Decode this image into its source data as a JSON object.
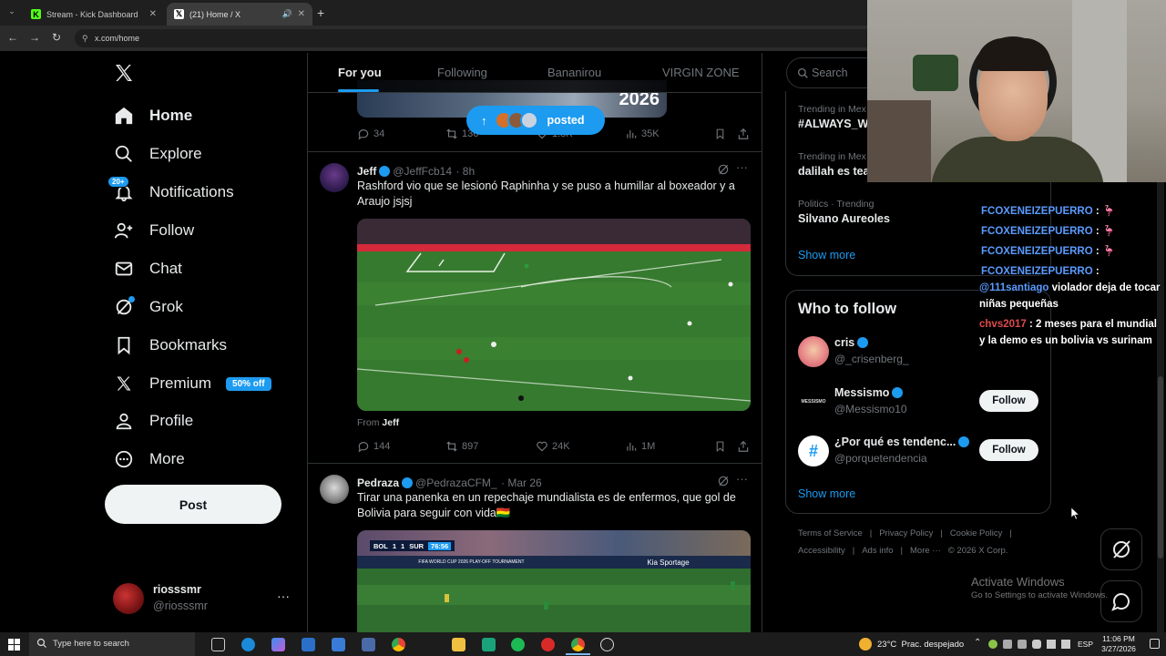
{
  "browser": {
    "tabs": [
      {
        "label": "Stream - Kick Dashboard"
      },
      {
        "label": "(21) Home / X"
      }
    ],
    "url": "x.com/home"
  },
  "sidebar": {
    "items": [
      {
        "label": "Home",
        "icon": "home-icon"
      },
      {
        "label": "Explore",
        "icon": "search-icon"
      },
      {
        "label": "Notifications",
        "icon": "bell-icon",
        "badge": "20+"
      },
      {
        "label": "Follow",
        "icon": "person-plus-icon"
      },
      {
        "label": "Chat",
        "icon": "mail-icon"
      },
      {
        "label": "Grok",
        "icon": "grok-icon"
      },
      {
        "label": "Bookmarks",
        "icon": "bookmark-icon"
      },
      {
        "label": "Premium",
        "icon": "x-logo-icon",
        "badge": "50% off"
      },
      {
        "label": "Profile",
        "icon": "person-icon"
      },
      {
        "label": "More",
        "icon": "more-circle-icon"
      }
    ],
    "post_label": "Post",
    "account": {
      "name": "riosssmr",
      "handle": "@riosssmr"
    }
  },
  "feed": {
    "tabs": [
      "For you",
      "Following",
      "Bananirou",
      "VIRGIN ZONE"
    ],
    "posted_pill": "posted",
    "top_tweet": {
      "replies": "34",
      "reposts": "136",
      "likes": "1.8K",
      "views": "35K",
      "banner_text": "2026"
    },
    "tweets": [
      {
        "name": "Jeff",
        "handle": "@JeffFcb14",
        "time": "· 8h",
        "text": "Rashford vio que se lesionó Raphinha y se puso a humillar al boxeador y a Araujo jsjsj",
        "from_label": "From",
        "from_name": "Jeff",
        "replies": "144",
        "reposts": "897",
        "likes": "24K",
        "views": "1M"
      },
      {
        "name": "Pedraza",
        "handle": "@PedrazaCFM_",
        "time": "· Mar 26",
        "text": "Tirar una panenka en un repechaje mundialista es de enfermos, que gol de Bolivia para seguir con vida🇧🇴",
        "score": {
          "home": "BOL",
          "home_goals": "1",
          "away_goals": "1",
          "away": "SUR",
          "clock": "76:56"
        },
        "video_caption": "FIFA WORLD CUP 2026 PLAY-OFF TOURNAMENT",
        "ad_board": "Kia Sportage"
      }
    ]
  },
  "right": {
    "search_placeholder": "Search",
    "trends": [
      {
        "category": "Trending in Mex",
        "name": "#ALWAYS_WI"
      },
      {
        "category": "Trending in Mex",
        "name": "dalilah es tea"
      },
      {
        "category": "Politics · Trending",
        "name": "Silvano Aureoles"
      }
    ],
    "show_more": "Show more",
    "who_to_follow_title": "Who to follow",
    "suggestions": [
      {
        "name": "cris",
        "handle": "@_crisenberg_",
        "button": ""
      },
      {
        "name": "Messismo",
        "handle": "@Messismo10",
        "button": "Follow"
      },
      {
        "name": "¿Por qué es tendenc...",
        "handle": "@porquetendencia",
        "button": "Follow"
      }
    ],
    "show_more_2": "Show more",
    "footer": {
      "line1": [
        "Terms of Service",
        "|",
        "Privacy Policy",
        "|",
        "Cookie Policy",
        "|"
      ],
      "line2": [
        "Accessibility",
        "|",
        "Ads info",
        "|",
        "More ···",
        "© 2026 X Corp."
      ]
    }
  },
  "chat_overlay": {
    "messages": [
      {
        "user": "FCOXENEIZEPUERRO",
        "sep": ":",
        "text": "🦩"
      },
      {
        "user": "FCOXENEIZEPUERRO",
        "sep": ":",
        "text": "🦩"
      },
      {
        "user": "FCOXENEIZEPUERRO",
        "sep": ":",
        "text": "🦩"
      },
      {
        "user": "FCOXENEIZEPUERRO",
        "sep": ":",
        "text": ""
      },
      {
        "user": "@111santiago",
        "sep": "",
        "text": "violador deja de tocar niñas pequeñas"
      },
      {
        "user": "chvs2017",
        "sep": ":",
        "text": "2 meses para el mundial y la demo es un bolivia vs surinam"
      }
    ]
  },
  "windows": {
    "activate_title": "Activate Windows",
    "activate_sub": "Go to Settings to activate Windows."
  },
  "taskbar": {
    "search_placeholder": "Type here to search",
    "weather": "23°C  Prac. despejado",
    "lang": "ESP",
    "time": "11:06 PM",
    "date": "3/27/2026"
  },
  "colors": {
    "accent": "#1d9bf0",
    "background": "#000000",
    "follow_button": "#eff3f4",
    "kick_green": "#53fc18"
  }
}
